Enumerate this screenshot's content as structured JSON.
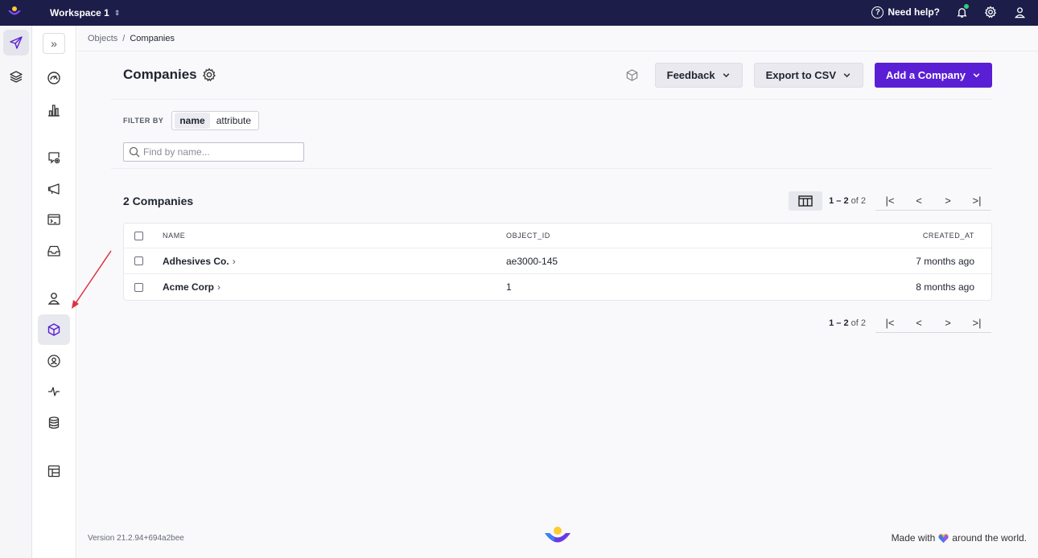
{
  "topbar": {
    "workspace": "Workspace 1",
    "help_label": "Need help?",
    "help_glyph": "?"
  },
  "sidebar_primary": [
    {
      "name": "messaging",
      "icon": "send-icon",
      "active": true
    },
    {
      "name": "stacks",
      "icon": "layers-icon",
      "active": false
    }
  ],
  "sidebar_secondary": {
    "collapse_glyph": "»",
    "items": [
      {
        "name": "dashboard",
        "icon": "gauge-icon"
      },
      {
        "name": "analytics",
        "icon": "bar-chart-icon"
      },
      {
        "name": "journeys",
        "icon": "message-icon"
      },
      {
        "name": "broadcasts",
        "icon": "megaphone-icon"
      },
      {
        "name": "transactional",
        "icon": "terminal-icon"
      },
      {
        "name": "deliveries",
        "icon": "inbox-icon"
      },
      {
        "name": "people",
        "icon": "person-icon"
      },
      {
        "name": "objects",
        "icon": "cube-icon",
        "active": true
      },
      {
        "name": "segments",
        "icon": "user-circle-icon"
      },
      {
        "name": "activity",
        "icon": "pulse-icon"
      },
      {
        "name": "data",
        "icon": "database-icon"
      },
      {
        "name": "content",
        "icon": "layout-icon"
      }
    ]
  },
  "breadcrumb": {
    "parent": "Objects",
    "separator": "/",
    "current": "Companies"
  },
  "header": {
    "title": "Companies",
    "feedback_label": "Feedback",
    "export_label": "Export to CSV",
    "add_label": "Add a Company"
  },
  "filter": {
    "label": "FILTER BY",
    "options": [
      "name",
      "attribute"
    ],
    "selected": "name",
    "search_placeholder": "Find by name..."
  },
  "results": {
    "count_label": "2 Companies",
    "range_label": "1 – 2",
    "of_label": "of 2"
  },
  "table": {
    "columns": [
      "NAME",
      "OBJECT_ID",
      "CREATED_AT"
    ],
    "rows": [
      {
        "name": "Adhesives Co.",
        "object_id": "ae3000-145",
        "created_at": "7 months ago"
      },
      {
        "name": "Acme Corp",
        "object_id": "1",
        "created_at": "8 months ago"
      }
    ]
  },
  "footer": {
    "version": "Version 21.2.94+694a2bee",
    "made_with_prefix": "Made with",
    "made_with_suffix": "around the world."
  },
  "colors": {
    "topbar_bg": "#1d1d4a",
    "primary": "#5a1fd4",
    "annotation_arrow": "#e0313f",
    "notification_dot": "#2dd07a"
  }
}
